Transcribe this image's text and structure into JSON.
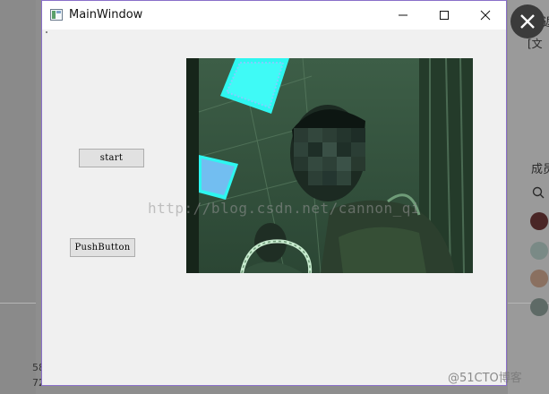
{
  "window": {
    "title": "MainWindow",
    "buttons": {
      "minimize": "minimize",
      "maximize": "maximize",
      "close": "close"
    }
  },
  "controls": {
    "start_label": "start",
    "push_label": "PushButton"
  },
  "camera_view": {
    "icon": "camera-feed"
  },
  "watermark": {
    "text": "http://blog.csdn.net/cannon_qi"
  },
  "corner_badge": {
    "text": "@51CTO博客"
  },
  "background": {
    "right_texts": [
      "返",
      "[文",
      "成员"
    ],
    "bottom_left": [
      "58",
      "72"
    ]
  },
  "colors": {
    "window_border": "#8a6fc9",
    "overlay_close": "#3b3b3b"
  }
}
